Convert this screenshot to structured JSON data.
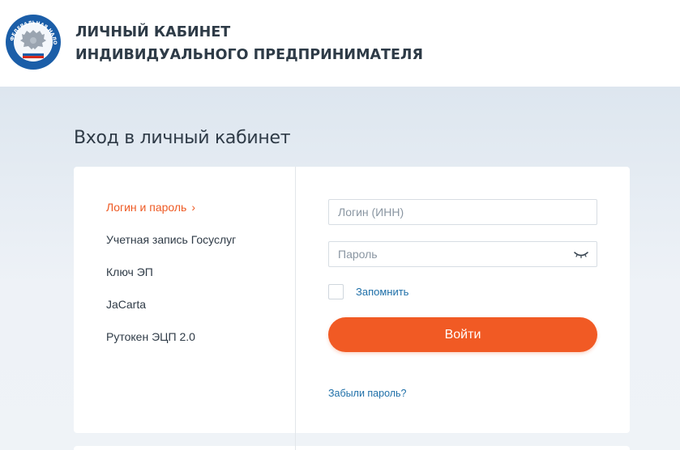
{
  "header": {
    "title_line1": "ЛИЧНЫЙ КАБИНЕТ",
    "title_line2": "ИНДИВИДУАЛЬНОГО ПРЕДПРИНИМАТЕЛЯ",
    "logo_icon": "fns-emblem-icon",
    "logo_text": "ФЕДЕРАЛЬНАЯ НАЛОГОВАЯ СЛУЖБА"
  },
  "page": {
    "title": "Вход в личный кабинет"
  },
  "login_methods": [
    {
      "label": "Логин и пароль",
      "active": true,
      "icon": "chevron-right-icon"
    },
    {
      "label": "Учетная запись Госуслуг",
      "active": false
    },
    {
      "label": "Ключ ЭП",
      "active": false
    },
    {
      "label": "JaCarta",
      "active": false
    },
    {
      "label": "Рутокен ЭЦП 2.0",
      "active": false
    }
  ],
  "form": {
    "login_placeholder": "Логин (ИНН)",
    "login_value": "",
    "password_placeholder": "Пароль",
    "password_value": "",
    "password_toggle_icon": "eye-closed-icon",
    "remember_label": "Запомнить",
    "remember_checked": false,
    "submit_label": "Войти",
    "forgot_label": "Забыли пароль?"
  },
  "colors": {
    "accent": "#f15a24",
    "link": "#1e6fa8",
    "text": "#2f3b47",
    "background": "#eef2f7"
  }
}
